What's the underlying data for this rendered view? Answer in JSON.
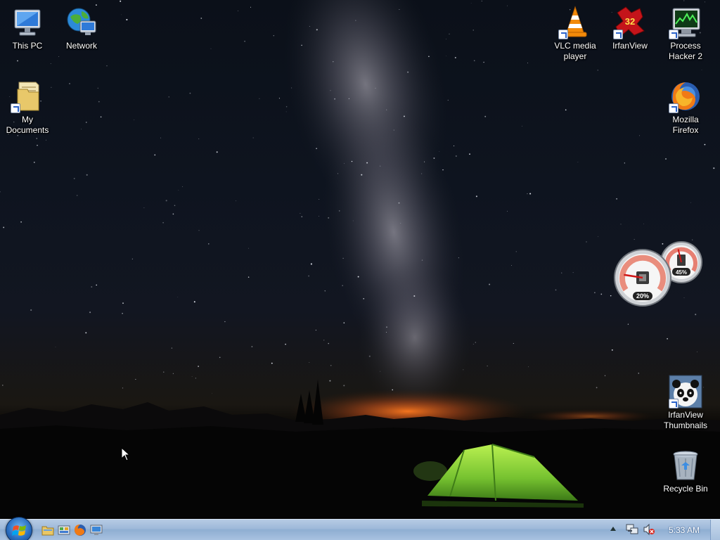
{
  "desktop": {
    "icons": [
      {
        "label": "This PC",
        "icon": "computer-icon"
      },
      {
        "label": "Network",
        "icon": "network-globe-icon"
      },
      {
        "label": "My Documents",
        "icon": "documents-folder-icon"
      },
      {
        "label": "VLC media player",
        "icon": "vlc-cone-icon"
      },
      {
        "label": "IrfanView",
        "icon": "irfanview-icon"
      },
      {
        "label": "Process Hacker 2",
        "icon": "process-hacker-icon"
      },
      {
        "label": "Mozilla Firefox",
        "icon": "firefox-icon"
      },
      {
        "label": "IrfanView Thumbnails",
        "icon": "panda-icon"
      },
      {
        "label": "Recycle Bin",
        "icon": "recycle-bin-icon"
      }
    ],
    "irfanview_badge": "32"
  },
  "gadget": {
    "cpu_percent": "20%",
    "memory_percent": "45%",
    "cpu_value": 0.2,
    "memory_value": 0.45
  },
  "taskbar": {
    "quick_launch": [
      "file-explorer-icon",
      "control-panel-icon",
      "firefox-icon",
      "remote-desktop-icon"
    ],
    "tray": [
      "show-hidden-icons-chevron",
      "network-icon",
      "volume-muted-icon"
    ],
    "clock": "5:33 AM"
  },
  "colors": {
    "taskbar": "#9db8d9",
    "tent": "#7cc83a",
    "horizon_glow": "#e0661a"
  }
}
